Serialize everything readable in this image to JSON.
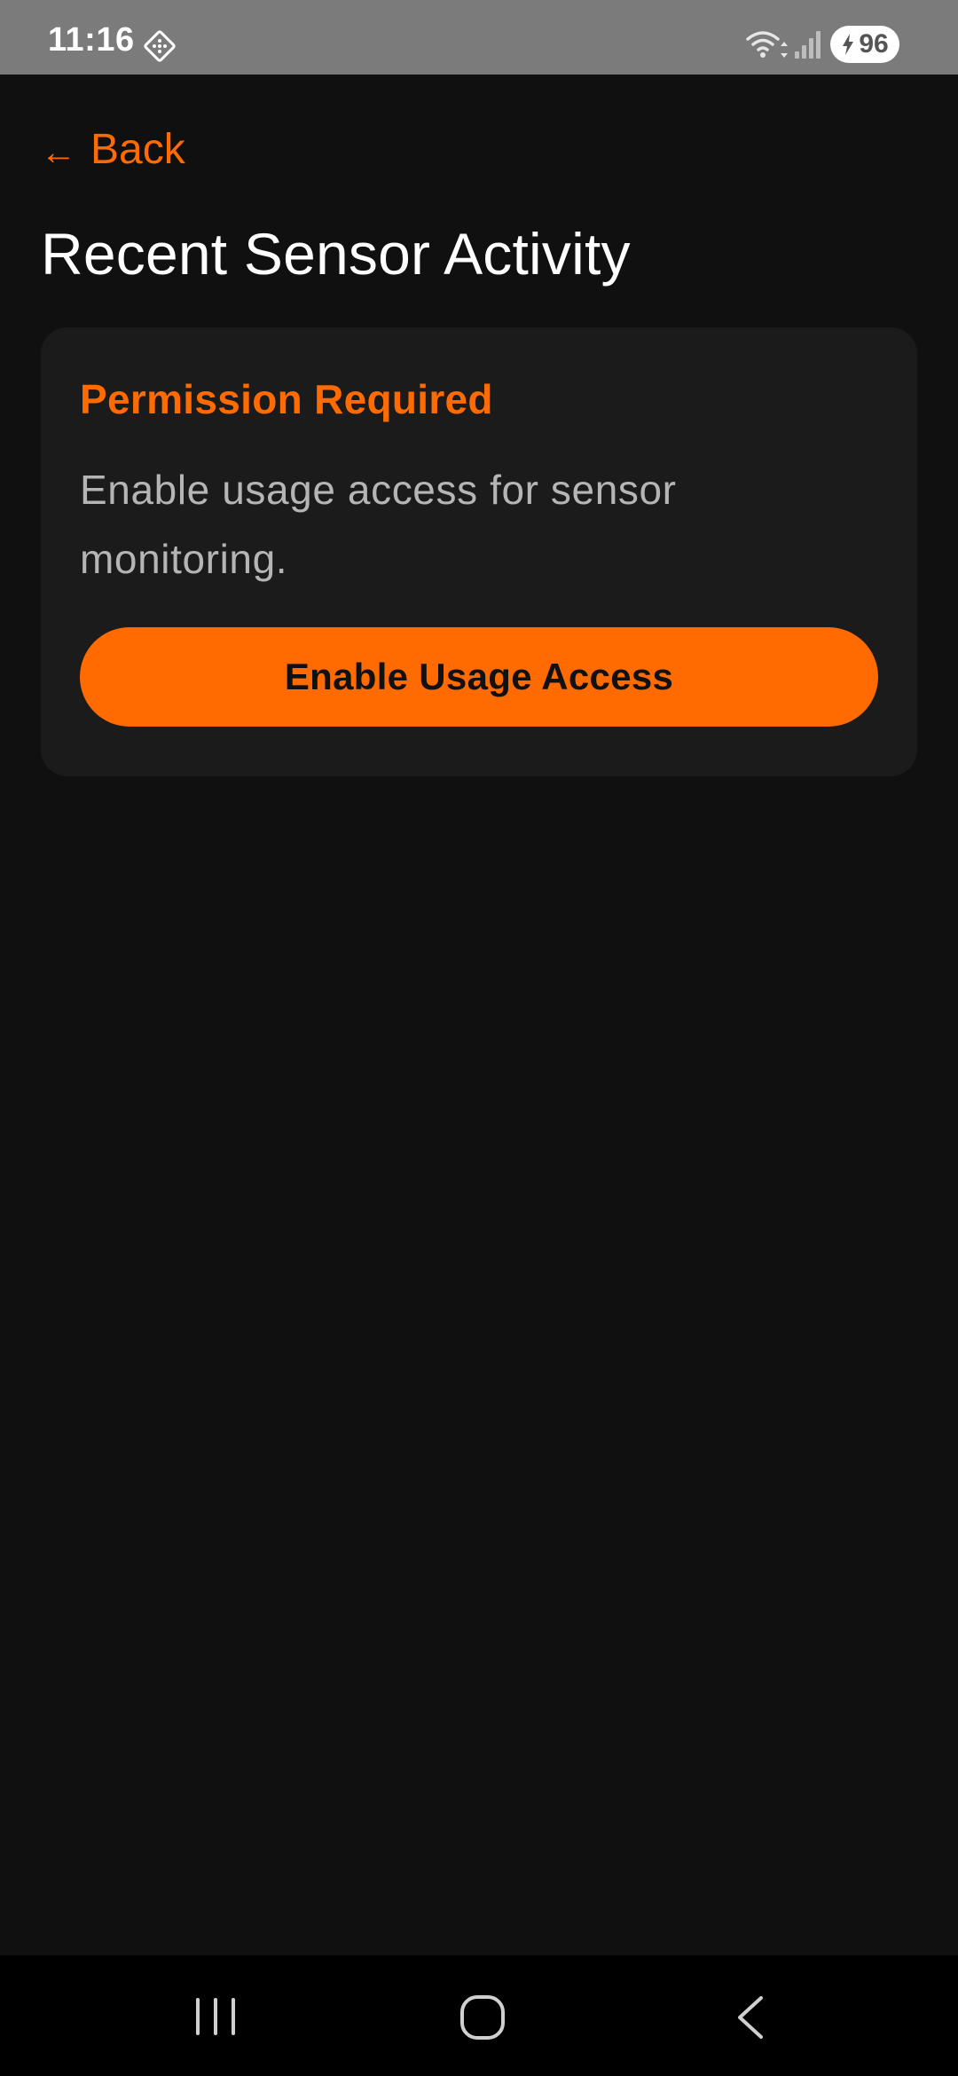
{
  "status_bar": {
    "time": "11:16",
    "battery_level": "96",
    "icons": [
      "app-notification-icon",
      "wifi-icon",
      "signal-icon",
      "battery-charging-icon"
    ]
  },
  "header": {
    "back_arrow": "←",
    "back_label": "Back",
    "title": "Recent Sensor Activity"
  },
  "permission_card": {
    "title": "Permission Required",
    "description": "Enable usage access for sensor monitoring.",
    "button_label": "Enable Usage Access"
  },
  "nav_bar": {
    "icons": [
      "recents-icon",
      "home-icon",
      "back-icon"
    ]
  },
  "colors": {
    "accent": "#ff6b00",
    "background": "#101010",
    "card": "#1b1b1b",
    "status_bar": "#7b7b7b",
    "nav_bar": "#000000"
  }
}
